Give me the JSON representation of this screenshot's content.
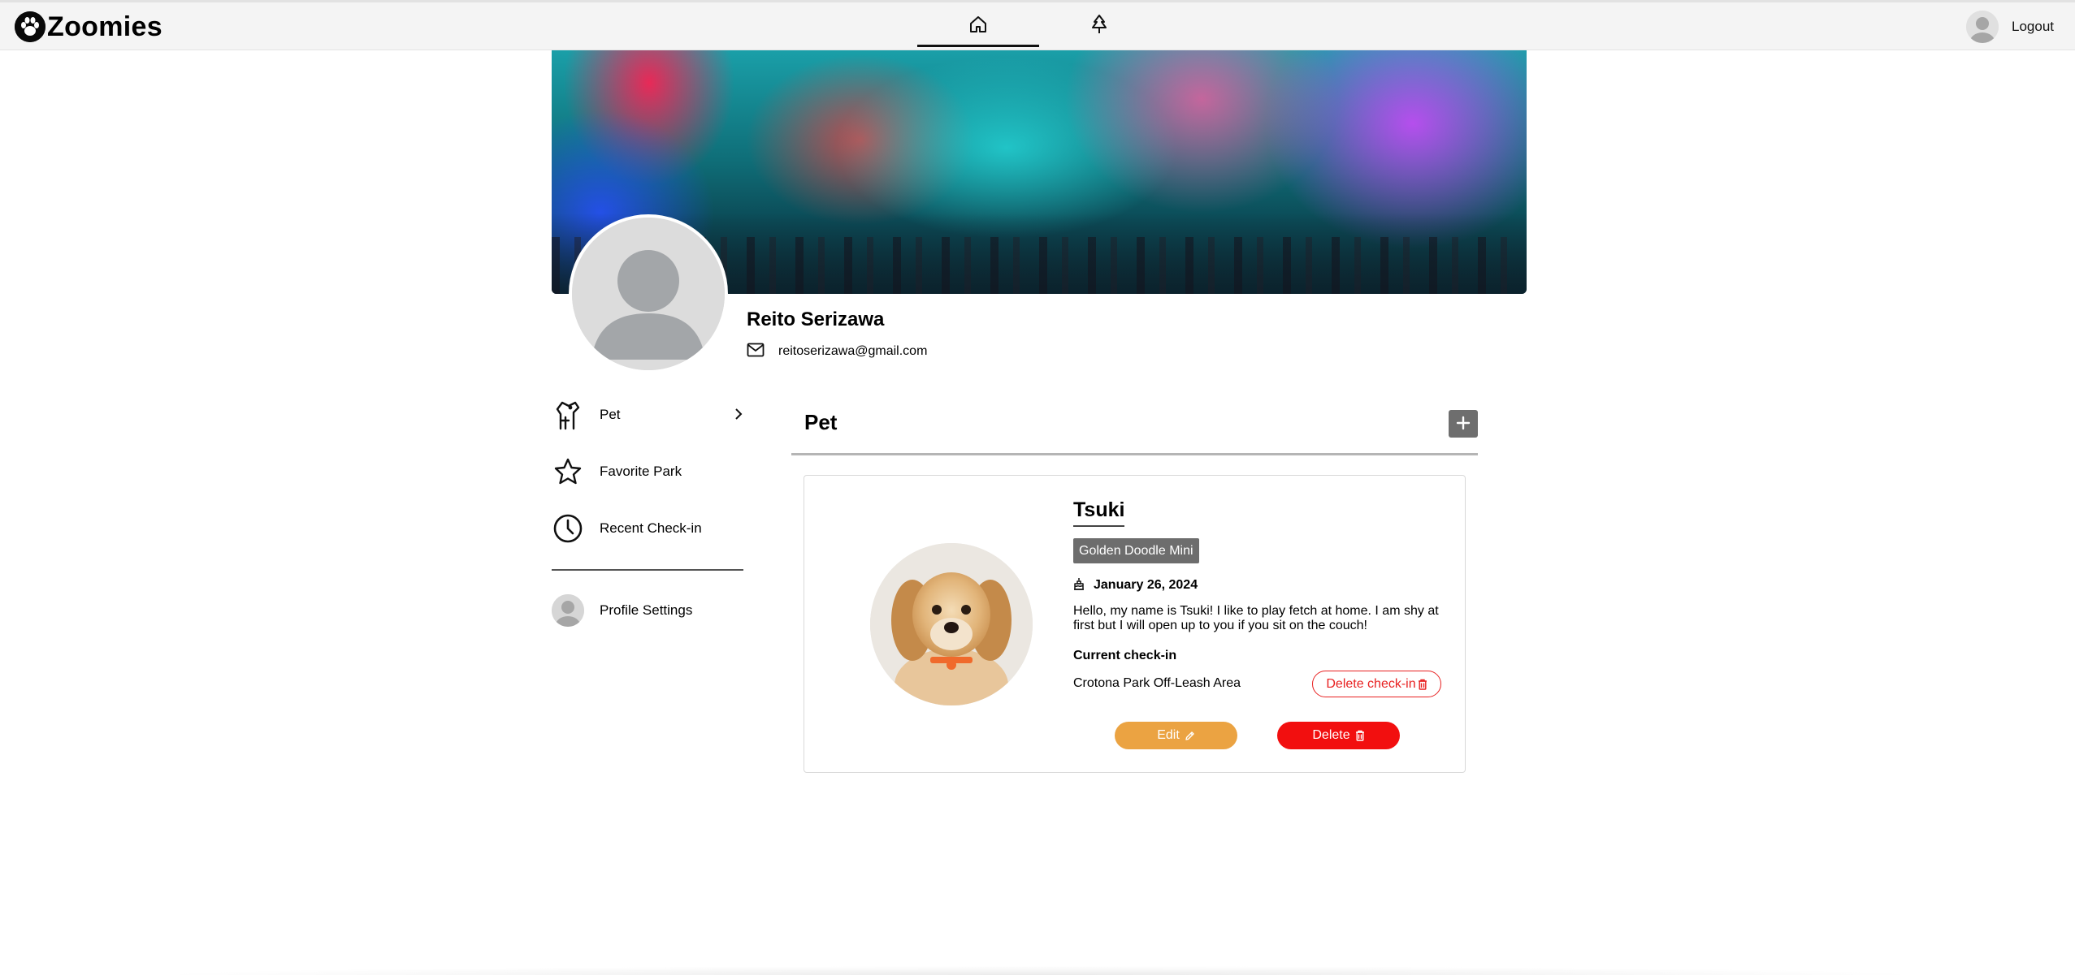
{
  "nav": {
    "brand": "Zoomies",
    "icons": {
      "brand": "paw-icon",
      "home": "home-icon",
      "parks": "tree-icon"
    },
    "logout_label": "Logout",
    "active_tab": "home"
  },
  "profile": {
    "name": "Reito Serizawa",
    "email": "reitoserizawa@gmail.com"
  },
  "sidebar": {
    "items": [
      {
        "label": "Pet",
        "icon": "dog-icon",
        "active": true
      },
      {
        "label": "Favorite Park",
        "icon": "star-icon"
      },
      {
        "label": "Recent Check-in",
        "icon": "clock-icon"
      },
      {
        "label": "Profile Settings",
        "icon": "avatar-icon"
      }
    ]
  },
  "pet_section": {
    "title": "Pet",
    "add_icon": "plus-icon"
  },
  "pet": {
    "name": "Tsuki",
    "breed": "Golden Doodle Mini",
    "birthday": "January 26, 2024",
    "bio": "Hello, my name is Tsuki! I like to play fetch at home. I am shy at first but I will open up to you if you sit on the couch!",
    "current_checkin_label": "Current check-in",
    "current_checkin_park": "Crotona Park Off-Leash Area",
    "delete_checkin_label": "Delete check-in",
    "edit_label": "Edit",
    "delete_label": "Delete"
  },
  "colors": {
    "edit": "#eba342",
    "delete": "#f20f0f",
    "breed_badge": "#6d6d6d",
    "nav_bg": "#f4f4f4"
  }
}
